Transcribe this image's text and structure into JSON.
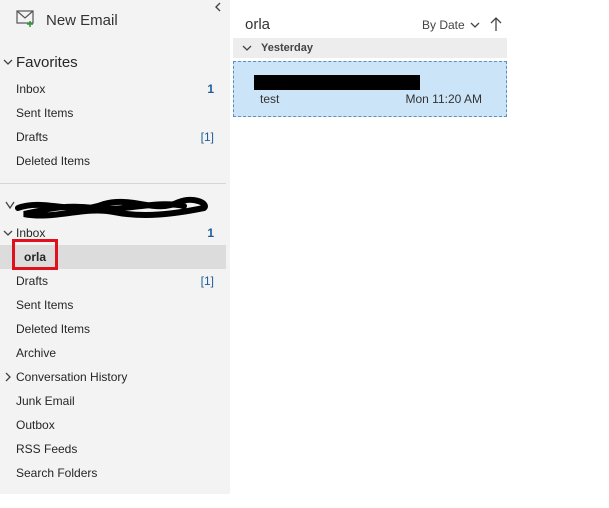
{
  "sidebar": {
    "new_email_label": "New Email",
    "favorites": {
      "title": "Favorites",
      "items": [
        {
          "label": "Inbox",
          "count": "1"
        },
        {
          "label": "Sent Items",
          "count": ""
        },
        {
          "label": "Drafts",
          "count": "[1]"
        },
        {
          "label": "Deleted Items",
          "count": ""
        }
      ]
    },
    "account": {
      "items": [
        {
          "label": "Inbox",
          "count": "1"
        },
        {
          "label": "orla",
          "count": ""
        },
        {
          "label": "Drafts",
          "count": "[1]"
        },
        {
          "label": "Sent Items",
          "count": ""
        },
        {
          "label": "Deleted Items",
          "count": ""
        },
        {
          "label": "Archive",
          "count": ""
        },
        {
          "label": "Conversation History",
          "count": ""
        },
        {
          "label": "Junk Email",
          "count": ""
        },
        {
          "label": "Outbox",
          "count": ""
        },
        {
          "label": "RSS Feeds",
          "count": ""
        },
        {
          "label": "Search Folders",
          "count": ""
        }
      ]
    }
  },
  "message_list": {
    "folder_title": "orla",
    "sort_label": "By Date",
    "group_label": "Yesterday",
    "messages": [
      {
        "subject": "test",
        "time": "Mon 11:20 AM"
      }
    ]
  },
  "colors": {
    "accent_count": "#1f5c99",
    "highlight_box": "#e0111c",
    "selected_message": "#cce4f7"
  },
  "icons": [
    "new-email-icon",
    "collapse-chevron-left-icon",
    "chevron-down-icon",
    "chevron-right-icon",
    "sort-chevron-down-icon",
    "sort-arrow-up-icon"
  ]
}
